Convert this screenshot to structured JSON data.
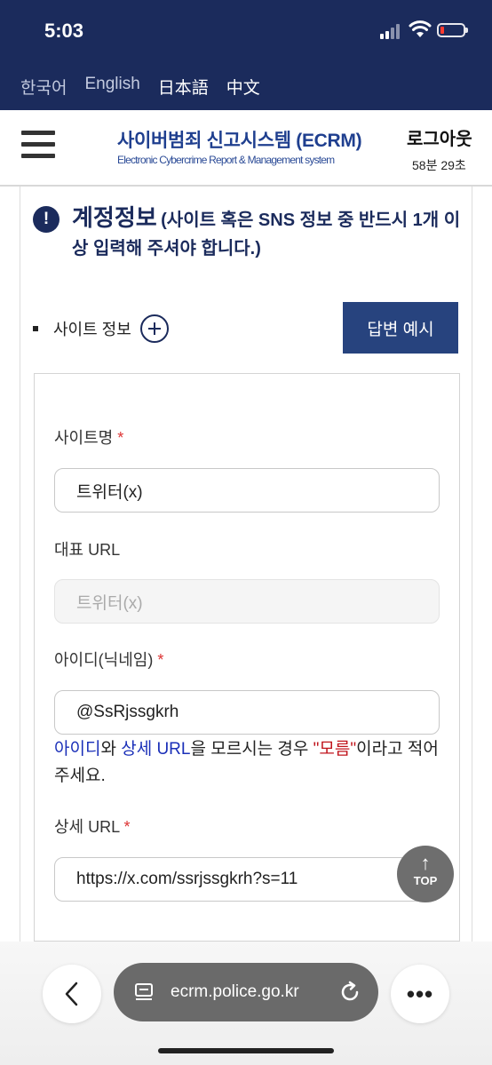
{
  "status_bar": {
    "time": "5:03"
  },
  "languages": [
    {
      "label": "한국어",
      "active": false
    },
    {
      "label": "English",
      "active": false
    },
    {
      "label": "日本語",
      "active": true
    },
    {
      "label": "中文",
      "active": true
    }
  ],
  "header": {
    "title": "사이버범죄 신고시스템 (ECRM)",
    "subtitle": "Electronic Cybercrime Report & Management system",
    "logout_label": "로그아웃",
    "session_timer": "58분 29초"
  },
  "section": {
    "title": "계정정보",
    "note": "(사이트 혹은 SNS 정보 중 반드시 1개 이상 입력해 주셔야 합니다.)"
  },
  "site_info": {
    "label": "사이트 정보",
    "example_button": "답변 예시"
  },
  "form": {
    "site_name": {
      "label": "사이트명",
      "required_mark": "*",
      "value": "트위터(x)"
    },
    "rep_url": {
      "label": "대표 URL",
      "placeholder": "트위터(x)"
    },
    "user_id": {
      "label": "아이디(닉네임)",
      "required_mark": "*",
      "value": "@SsRjssgkrh"
    },
    "hint": {
      "part1": "아이디",
      "part2": "와 ",
      "part3": "상세 URL",
      "part4": "을 모르시는 경우 ",
      "part5": "\"모름\"",
      "part6": "이라고 적어주세요."
    },
    "detail_url": {
      "label": "상세 URL",
      "required_mark": "*",
      "value": "https://x.com/ssrjssgkrh?s=11"
    }
  },
  "top_button": {
    "label": "TOP"
  },
  "browser": {
    "url": "ecrm.police.go.kr"
  },
  "colors": {
    "brand_navy": "#1b2b5c",
    "brand_blue": "#1f3f8f",
    "required_red": "#d33"
  }
}
